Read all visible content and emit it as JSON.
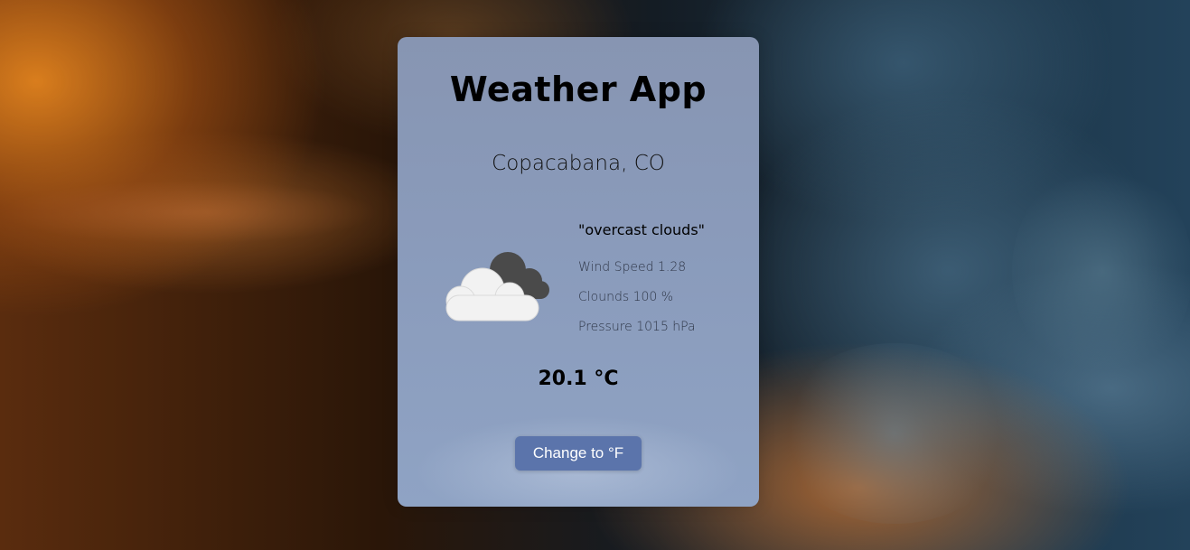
{
  "app": {
    "title": "Weather App"
  },
  "location": {
    "city": "Copacabana, CO"
  },
  "weather": {
    "icon": "overcast-clouds-icon",
    "description": "\"overcast clouds\"",
    "wind_speed": "Wind Speed 1.28",
    "clouds": "Clounds 100 %",
    "pressure": "Pressure 1015 hPa",
    "temperature": "20.1 °C"
  },
  "actions": {
    "toggle_unit_label": "Change to °F"
  },
  "colors": {
    "card": "#8a9bbb",
    "button": "#5b74ab",
    "button_text": "#ffffff"
  }
}
